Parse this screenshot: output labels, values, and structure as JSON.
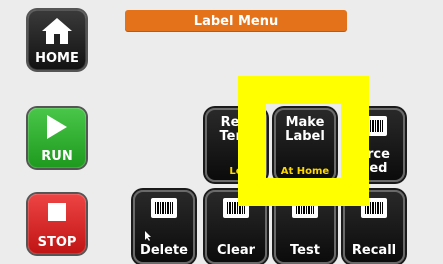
{
  "title": "Label Menu",
  "side": {
    "home": "HOME",
    "run": "RUN",
    "stop": "STOP"
  },
  "buttons": {
    "rewind_tension": {
      "line1": "Rew",
      "line2": "Tens",
      "sub": "Lo"
    },
    "make_label": {
      "line1": "Make",
      "line2": "Label",
      "sub": "At Home"
    },
    "force_feed": {
      "line1": "orce",
      "line2": "eed"
    },
    "delete": "Delete",
    "clear": "Clear",
    "test": "Test",
    "recall": "Recall"
  },
  "colors": {
    "title_bar": "#e4721a",
    "run": "#2fb12f",
    "stop": "#dd2222",
    "highlight": "#ffff00",
    "subtext": "#ffd700"
  }
}
